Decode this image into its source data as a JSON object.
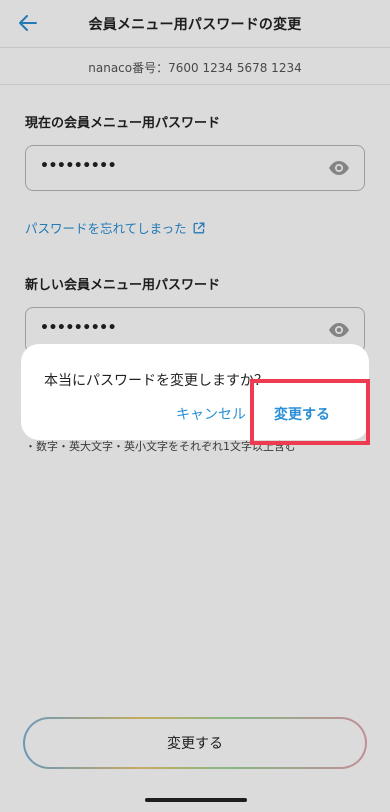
{
  "header": {
    "title": "会員メニュー用パスワードの変更",
    "back_icon": "arrow-left-icon"
  },
  "subheader": {
    "card_number_text": "nanaco番号：7600 1234 5678 1234"
  },
  "current_password": {
    "label": "現在の会員メニュー用パスワード",
    "value": "•••••••••",
    "toggle_icon": "eye-icon"
  },
  "forgot_link": {
    "label": "パスワードを忘れてしまった",
    "icon": "external-link-icon"
  },
  "new_password": {
    "label": "新しい会員メニュー用パスワード",
    "value": "•••••••••",
    "toggle_icon": "eye-icon"
  },
  "hint": {
    "text": "・数字・英大文字・英小文字をそれぞれ1文字以上含む"
  },
  "dialog": {
    "message": "本当にパスワードを変更しますか？",
    "cancel_label": "キャンセル",
    "confirm_label": "変更する"
  },
  "bottom_action": {
    "label": "変更する"
  },
  "colors": {
    "accent": "#2a8fd6",
    "highlight": "#ef3b4f"
  }
}
